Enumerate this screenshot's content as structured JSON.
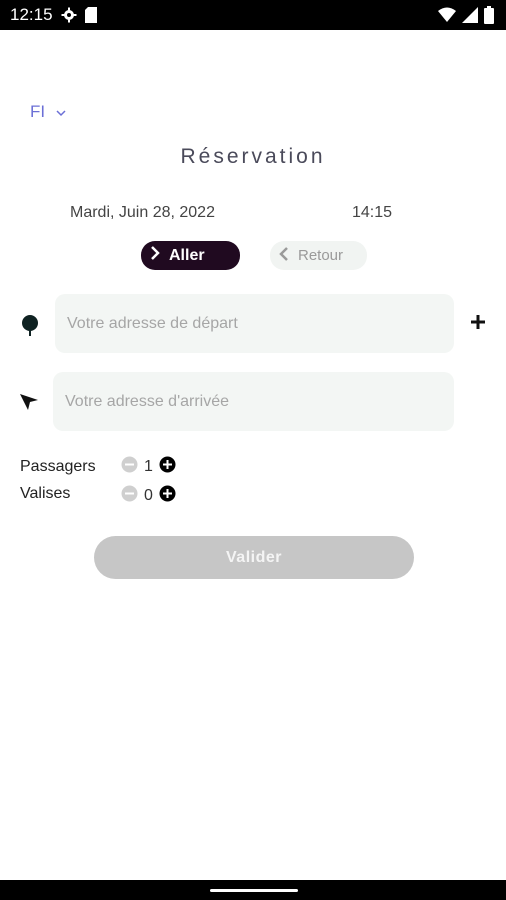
{
  "status_bar": {
    "time": "12:15"
  },
  "language": {
    "selected": "FI"
  },
  "page": {
    "title": "Réservation"
  },
  "trip": {
    "date": "Mardi, Juin 28, 2022",
    "time": "14:15"
  },
  "direction": {
    "outbound_label": "Aller",
    "return_label": "Retour"
  },
  "addresses": {
    "departure_placeholder": "Votre adresse de départ",
    "arrival_placeholder": "Votre adresse d'arrivée"
  },
  "counters": {
    "passengers": {
      "label": "Passagers",
      "value": "1"
    },
    "luggage": {
      "label": "Valises",
      "value": "0"
    }
  },
  "actions": {
    "submit_label": "Valider"
  },
  "colors": {
    "accent": "#6b6fd6",
    "aller_bg": "#200a20",
    "field_bg": "#f3f6f4",
    "button_disabled": "#c6c6c6"
  }
}
